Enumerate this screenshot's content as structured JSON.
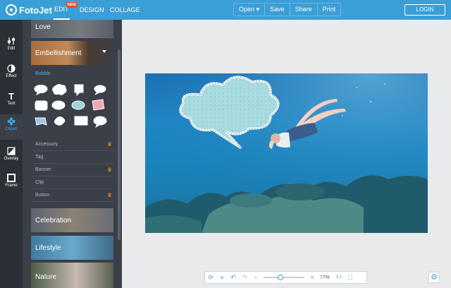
{
  "app": {
    "name": "FotoJet"
  },
  "topnav": {
    "edit": "EDIT",
    "new_badge": "NEW",
    "design": "DESIGN",
    "collage": "COLLAGE"
  },
  "center_menu": {
    "open": "Open ▾",
    "save": "Save",
    "share": "Share",
    "print": "Print"
  },
  "login": "LOGIN",
  "rail": [
    {
      "label": "Edit",
      "icon": "sliders-icon"
    },
    {
      "label": "Effect",
      "icon": "half-circle-icon"
    },
    {
      "label": "Text",
      "icon": "text-t-icon"
    },
    {
      "label": "Clipart",
      "icon": "gear-flower-icon"
    },
    {
      "label": "Overlay",
      "icon": "overlay-icon"
    },
    {
      "label": "Frame",
      "icon": "frame-icon"
    }
  ],
  "panel": {
    "love": "Love",
    "embellishment": "Embellishment",
    "bubble_title": "Bubble",
    "subcategories": [
      {
        "label": "Accessory",
        "premium": true
      },
      {
        "label": "Tag",
        "premium": false
      },
      {
        "label": "Banner",
        "premium": true
      },
      {
        "label": "Clip",
        "premium": false
      },
      {
        "label": "Button",
        "premium": true
      }
    ],
    "celebration": "Celebration",
    "lifestyle": "Lifestyle",
    "nature": "Nature"
  },
  "zoom": {
    "value": "77%",
    "level": 0.77
  },
  "colors": {
    "topbar": "#3a9fd6",
    "rail": "#2b2f36",
    "panel": "#3a3f48",
    "accent": "#3ea6e6",
    "crown": "#f39c12"
  }
}
